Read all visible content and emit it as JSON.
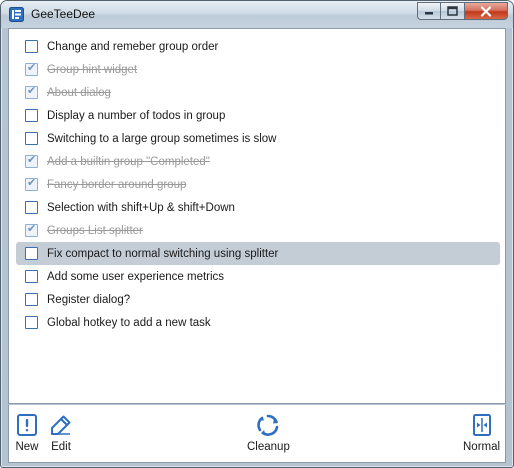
{
  "window": {
    "title": "GeeTeeDee",
    "icon": "app-icon",
    "controls": {
      "minimize": "minimize-icon",
      "maximize": "maximize-icon",
      "close": "close-icon"
    }
  },
  "todos": [
    {
      "label": "Change and remeber group order",
      "done": false
    },
    {
      "label": "Group hint widget",
      "done": true
    },
    {
      "label": "About dialog",
      "done": true
    },
    {
      "label": "Display a number of todos in group",
      "done": false
    },
    {
      "label": "Switching to a large group sometimes is slow",
      "done": false
    },
    {
      "label": "Add a builtin group \"Completed\"",
      "done": true
    },
    {
      "label": "Fancy border around group",
      "done": true
    },
    {
      "label": "Selection with shift+Up & shift+Down",
      "done": false
    },
    {
      "label": "Groups List splitter",
      "done": true
    },
    {
      "label": "Fix compact to normal switching using splitter",
      "done": false,
      "selected": true
    },
    {
      "label": "Add some user experience metrics",
      "done": false
    },
    {
      "label": "Register dialog?",
      "done": false
    },
    {
      "label": "Global hotkey to add a new task",
      "done": false
    }
  ],
  "toolbar": {
    "new_label": "New",
    "edit_label": "Edit",
    "cleanup_label": "Cleanup",
    "normal_label": "Normal"
  },
  "colors": {
    "accent": "#2f6fbf",
    "checkbox_border": "#3c6fb0",
    "done_text": "#9a9a9a",
    "selection": "#c4ccd6",
    "close_button": "#c2371c"
  }
}
